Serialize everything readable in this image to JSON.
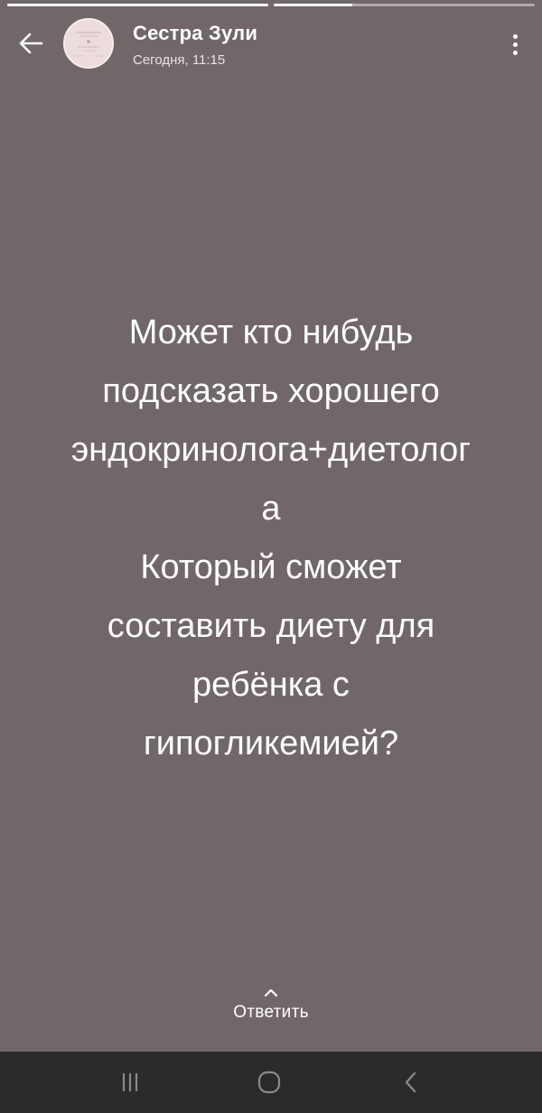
{
  "story": {
    "progress": [
      1.0,
      0.3
    ],
    "user_name": "Сестра Зули",
    "timestamp": "Сегодня, 11:15",
    "text_lines": [
      "Может кто нибудь",
      "подсказать хорошего",
      "эндокринолога+диетолог",
      "а",
      "Который сможет",
      "составить диету для",
      "ребёнка с",
      "гипогликемией?"
    ],
    "reply_label": "Ответить"
  },
  "icons": {
    "back": "arrow-left-icon",
    "menu": "more-vertical-icon",
    "reply": "chevron-up-icon",
    "nav_recents": "recent-apps-icon",
    "nav_home": "home-icon",
    "nav_back": "nav-back-icon"
  },
  "colors": {
    "background": "#716769",
    "navbar": "#2b2b2b",
    "avatar": "#ecdcdc"
  }
}
